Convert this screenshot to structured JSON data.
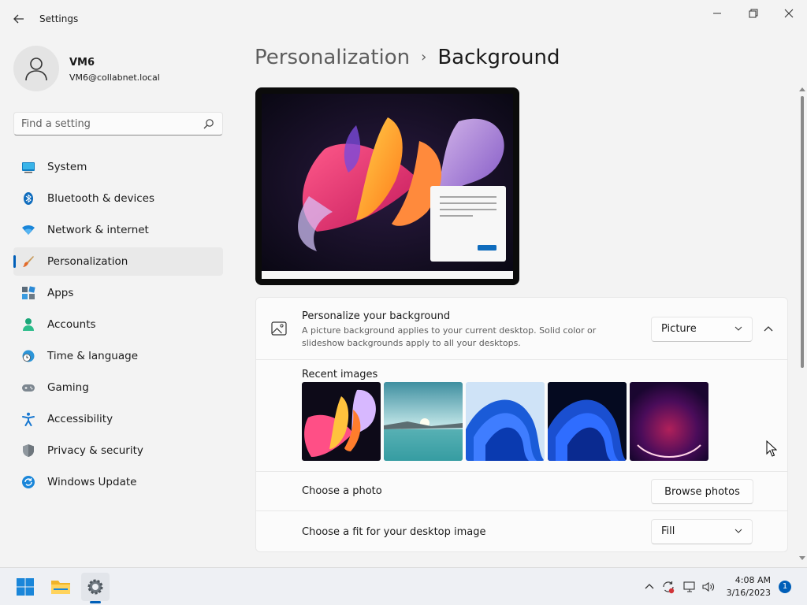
{
  "window": {
    "title": "Settings"
  },
  "user": {
    "name": "VM6",
    "email": "VM6@collabnet.local"
  },
  "search": {
    "placeholder": "Find a setting"
  },
  "sidebar": {
    "items": [
      {
        "label": "System",
        "icon": "monitor-icon"
      },
      {
        "label": "Bluetooth & devices",
        "icon": "bluetooth-icon"
      },
      {
        "label": "Network & internet",
        "icon": "wifi-icon"
      },
      {
        "label": "Personalization",
        "icon": "brush-icon",
        "active": true
      },
      {
        "label": "Apps",
        "icon": "apps-icon"
      },
      {
        "label": "Accounts",
        "icon": "person-icon"
      },
      {
        "label": "Time & language",
        "icon": "clock-globe-icon"
      },
      {
        "label": "Gaming",
        "icon": "gamepad-icon"
      },
      {
        "label": "Accessibility",
        "icon": "accessibility-icon"
      },
      {
        "label": "Privacy & security",
        "icon": "shield-icon"
      },
      {
        "label": "Windows Update",
        "icon": "update-icon"
      }
    ]
  },
  "breadcrumb": {
    "parent": "Personalization",
    "separator": "›",
    "current": "Background"
  },
  "background": {
    "title": "Personalize your background",
    "description": "A picture background applies to your current desktop. Solid color or slideshow backgrounds apply to all your desktops.",
    "type_value": "Picture"
  },
  "recent": {
    "title": "Recent images",
    "images": [
      "bloom-dark-wallpaper",
      "lake-sunrise-wallpaper",
      "blue-bloom-wallpaper",
      "blue-bloom-dark-wallpaper",
      "purple-glow-wallpaper"
    ]
  },
  "photo": {
    "label": "Choose a photo",
    "button": "Browse photos"
  },
  "fit": {
    "label": "Choose a fit for your desktop image",
    "value": "Fill"
  },
  "taskbar": {
    "time": "4:08 AM",
    "date": "3/16/2023",
    "notifications": "1"
  },
  "colors": {
    "accent": "#005fb8",
    "background": "#f3f3f3",
    "card": "#fbfbfb"
  }
}
